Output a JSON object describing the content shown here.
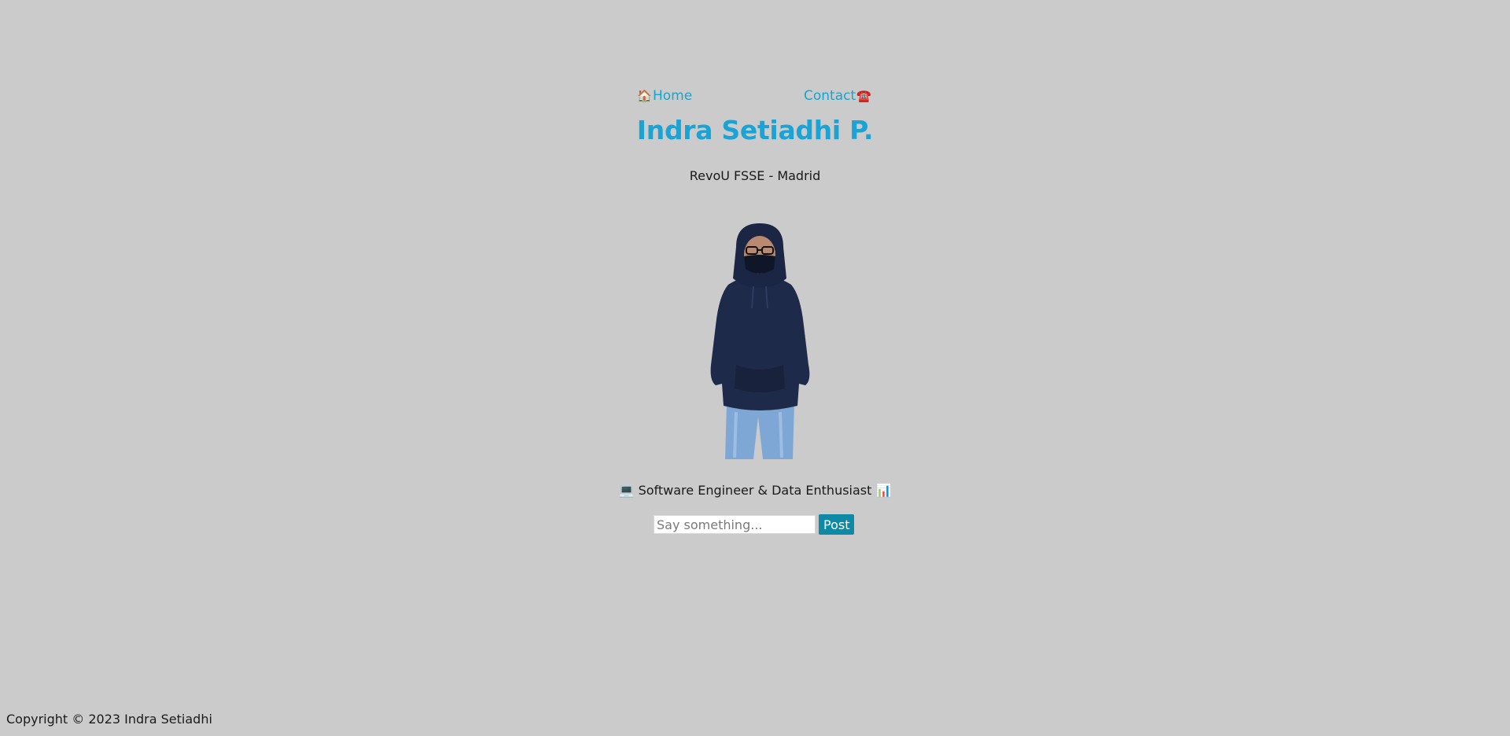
{
  "nav": {
    "home_icon": "🏠",
    "home_label": "Home",
    "contact_label": "Contact",
    "contact_icon": "☎️"
  },
  "header": {
    "title": "Indra Setiadhi P.",
    "subtitle": "RevoU FSSE - Madrid"
  },
  "profile": {
    "image_name": "profile-photo"
  },
  "tagline": {
    "text": "💻 Software Engineer & Data Enthusiast 📊"
  },
  "post_form": {
    "placeholder": "Say something...",
    "value": "",
    "button_label": "Post"
  },
  "footer": {
    "copyright": "Copyright © 2023 Indra Setiadhi"
  },
  "colors": {
    "background": "#cbcbcb",
    "accent": "#1aa3d4",
    "button": "#0e8aa6"
  }
}
